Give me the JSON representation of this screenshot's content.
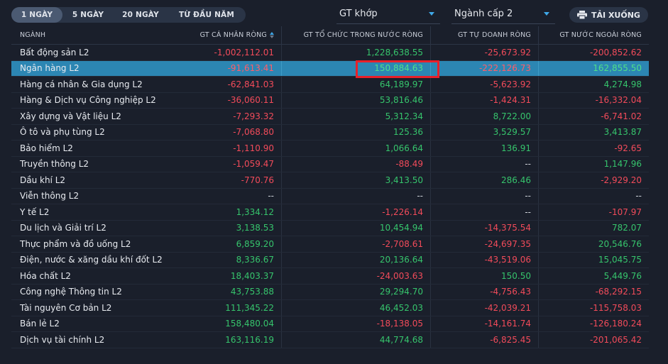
{
  "tabs": [
    {
      "label": "1 NGÀY",
      "active": true
    },
    {
      "label": "5 NGÀY",
      "active": false
    },
    {
      "label": "20 NGÀY",
      "active": false
    },
    {
      "label": "TỪ ĐẦU NĂM",
      "active": false
    }
  ],
  "selects": {
    "metric": "GT khớp",
    "level": "Ngành cấp 2"
  },
  "download": {
    "label": "TẢI XUỐNG",
    "icon": "printer-icon"
  },
  "headers": [
    "NGÀNH",
    "GT CÁ NHÂN RÒNG",
    "GT TỔ CHỨC TRONG NƯỚC RÒNG",
    "GT TỰ DOANH RÒNG",
    "GT NƯỚC NGOÀI RÒNG"
  ],
  "colors": {
    "positive": "#36c46c",
    "negative": "#f24b5a",
    "selected_row": "#2c86b3",
    "highlight_box": "#e8202a"
  },
  "selected_row_index": 1,
  "rows": [
    [
      "Bất động sản L2",
      "-1,002,112.01",
      "1,228,638.55",
      "-25,673.92",
      "-200,852.62"
    ],
    [
      "Ngân hàng L2",
      "-91,613.41",
      "150,884.63",
      "-222,126.73",
      "162,855.50"
    ],
    [
      "Hàng cá nhân & Gia dụng L2",
      "-62,841.03",
      "64,189.97",
      "-5,623.92",
      "4,274.98"
    ],
    [
      "Hàng & Dịch vụ Công nghiệp L2",
      "-36,060.11",
      "53,816.46",
      "-1,424.31",
      "-16,332.04"
    ],
    [
      "Xây dựng và Vật liệu L2",
      "-7,293.32",
      "5,312.34",
      "8,722.00",
      "-6,741.02"
    ],
    [
      "Ô tô và phụ tùng L2",
      "-7,068.80",
      "125.36",
      "3,529.57",
      "3,413.87"
    ],
    [
      "Bảo hiểm L2",
      "-1,110.90",
      "1,066.64",
      "136.91",
      "-92.65"
    ],
    [
      "Truyền thông L2",
      "-1,059.47",
      "-88.49",
      "--",
      "1,147.96"
    ],
    [
      "Dầu khí L2",
      "-770.76",
      "3,413.50",
      "286.46",
      "-2,929.20"
    ],
    [
      "Viễn thông L2",
      "--",
      "--",
      "--",
      "--"
    ],
    [
      "Y tế L2",
      "1,334.12",
      "-1,226.14",
      "--",
      "-107.97"
    ],
    [
      "Du lịch và Giải trí L2",
      "3,138.53",
      "10,454.94",
      "-14,375.54",
      "782.07"
    ],
    [
      "Thực phẩm và đồ uống L2",
      "6,859.20",
      "-2,708.61",
      "-24,697.35",
      "20,546.76"
    ],
    [
      "Điện, nước & xăng dầu khí đốt L2",
      "8,336.67",
      "20,136.64",
      "-43,519.06",
      "15,045.75"
    ],
    [
      "Hóa chất L2",
      "18,403.37",
      "-24,003.63",
      "150.50",
      "5,449.76"
    ],
    [
      "Công nghệ Thông tin L2",
      "43,753.88",
      "29,294.70",
      "-4,756.43",
      "-68,292.15"
    ],
    [
      "Tài nguyên Cơ bản L2",
      "111,345.22",
      "46,452.03",
      "-42,039.21",
      "-115,758.03"
    ],
    [
      "Bán lẻ L2",
      "158,480.04",
      "-18,138.05",
      "-14,161.74",
      "-126,180.24"
    ],
    [
      "Dịch vụ tài chính L2",
      "163,116.19",
      "44,774.68",
      "-6,825.45",
      "-201,065.42"
    ]
  ]
}
